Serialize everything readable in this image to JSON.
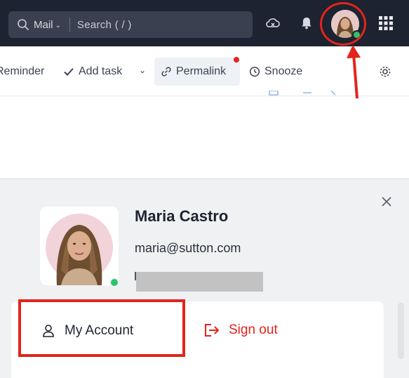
{
  "header": {
    "search_scope": "Mail",
    "search_placeholder": "Search ( / )"
  },
  "toolbar": {
    "reminder": "Reminder",
    "add_task": "Add task",
    "permalink": "Permalink",
    "snooze": "Snooze"
  },
  "profile": {
    "name": "Maria Castro",
    "email": "maria@sutton.com",
    "my_account": "My Account",
    "sign_out": "Sign out"
  },
  "colors": {
    "topbar": "#1d2330",
    "accent_red": "#e3241b",
    "online_green": "#2cc36b"
  }
}
